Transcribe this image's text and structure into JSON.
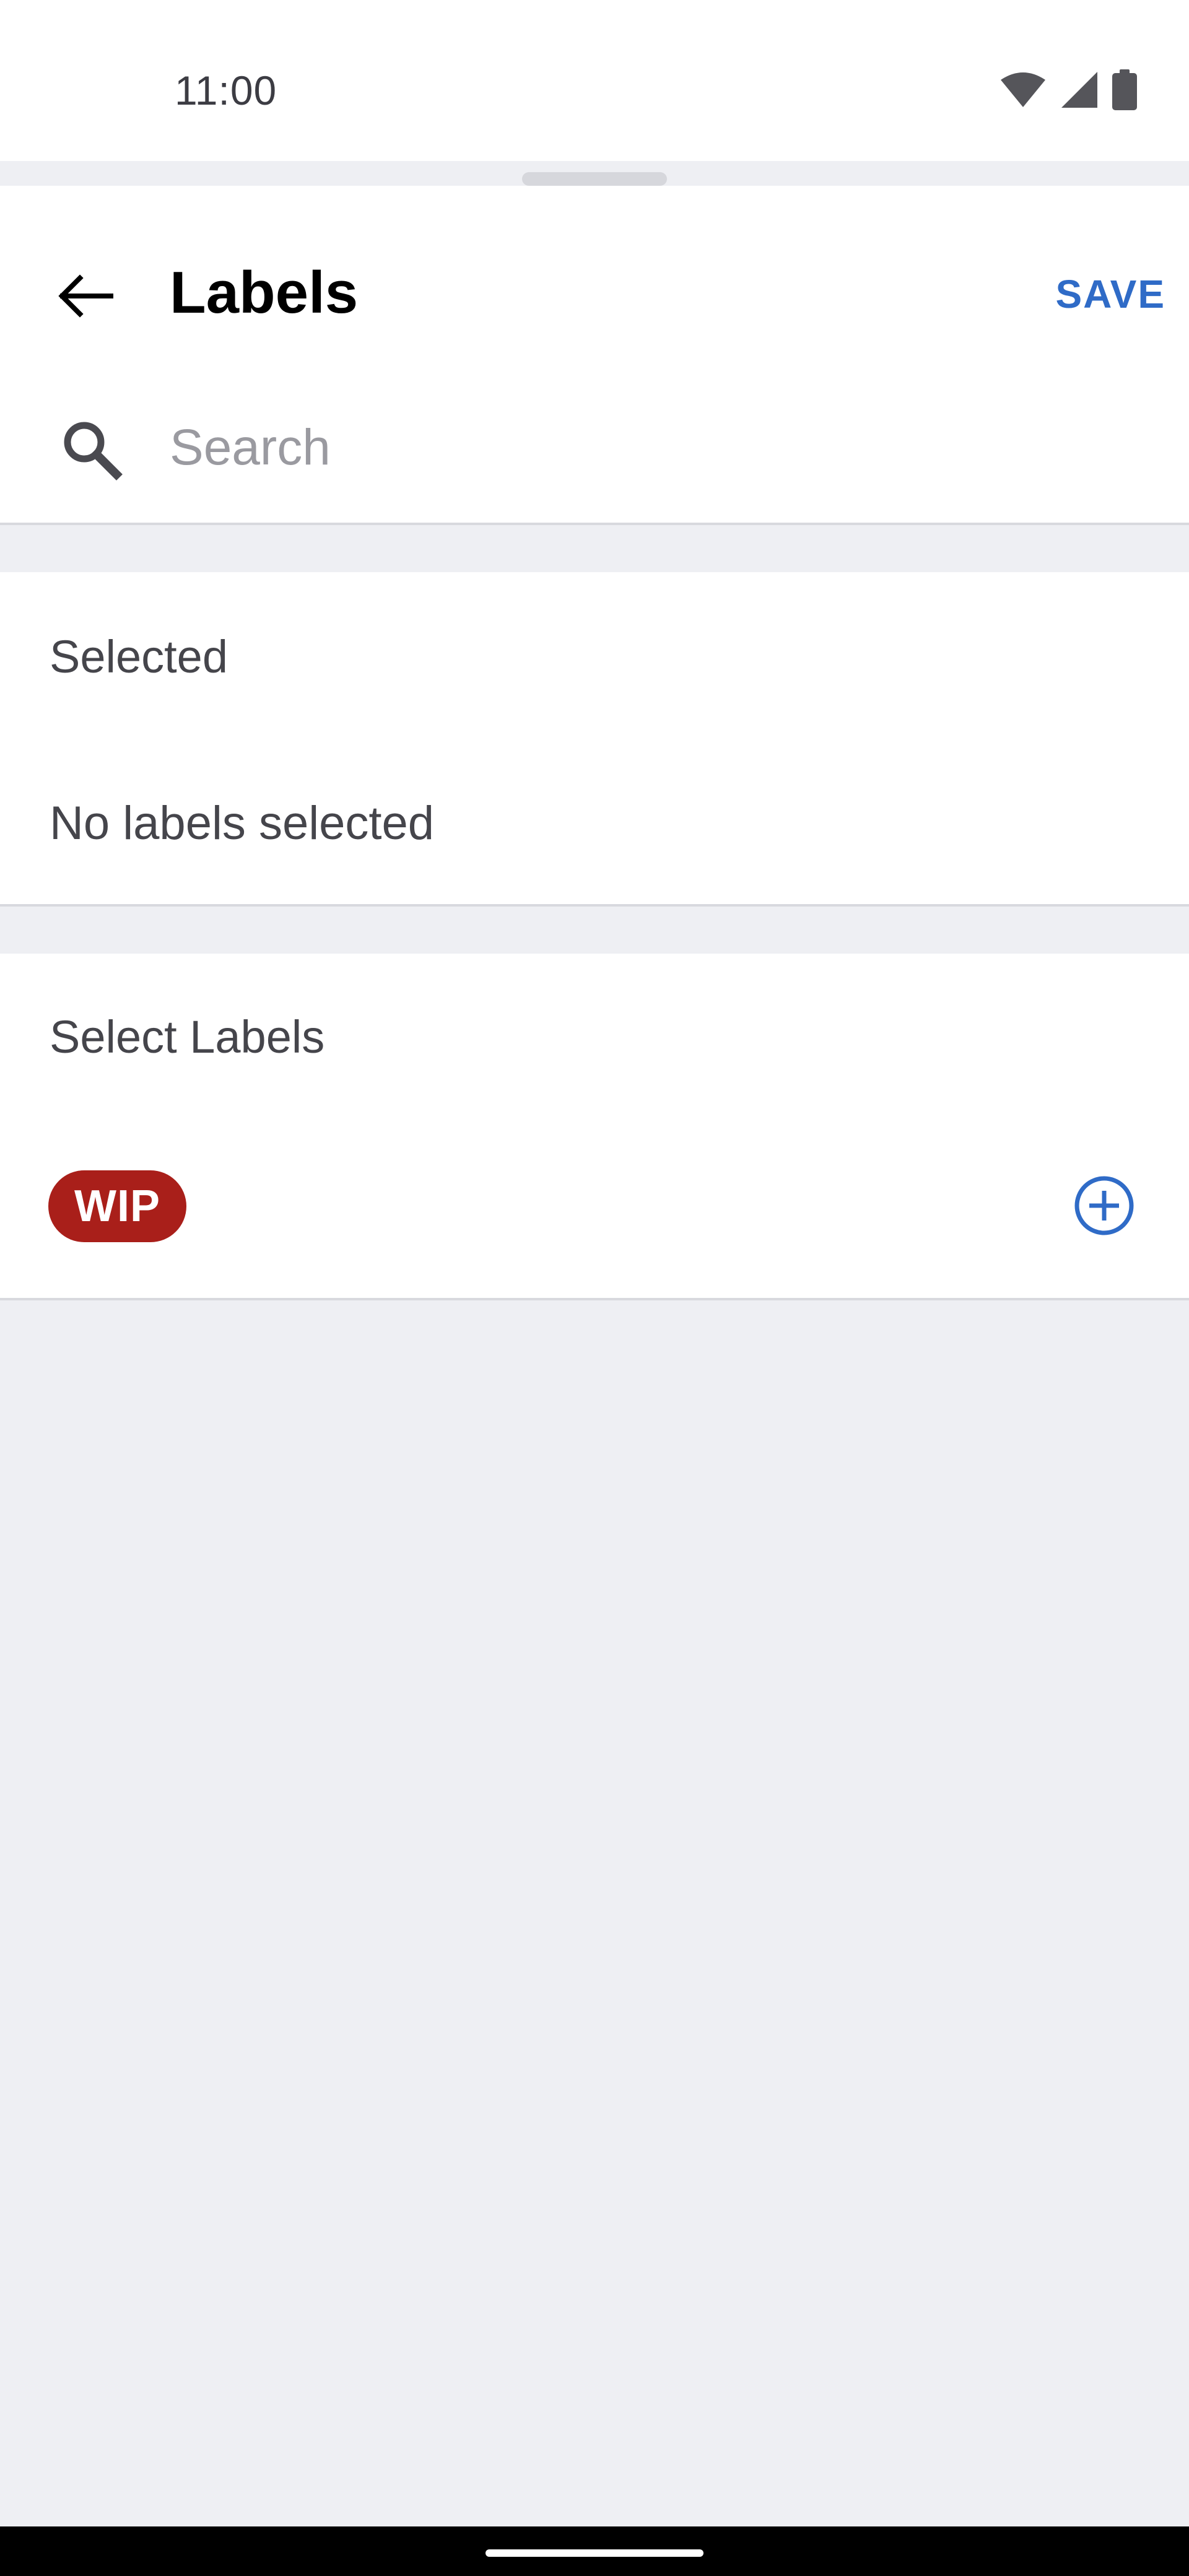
{
  "status_bar": {
    "time": "11:00",
    "icons": [
      "wifi-icon",
      "cellular-signal-icon",
      "battery-icon"
    ]
  },
  "header": {
    "title": "Labels",
    "save_label": "SAVE",
    "back_icon": "arrow-left-icon"
  },
  "search": {
    "placeholder": "Search",
    "value": "",
    "icon": "search-icon"
  },
  "selected_section": {
    "heading": "Selected",
    "empty_text": "No labels selected"
  },
  "select_labels_section": {
    "heading": "Select Labels",
    "labels": [
      {
        "name": "WIP",
        "color": "#A91F1A",
        "action_icon": "add-circle-icon"
      }
    ]
  },
  "colors": {
    "accent": "#2F6BC7",
    "background": "#EEEFF3",
    "surface": "#FFFFFF",
    "label_wip": "#A91F1A"
  }
}
